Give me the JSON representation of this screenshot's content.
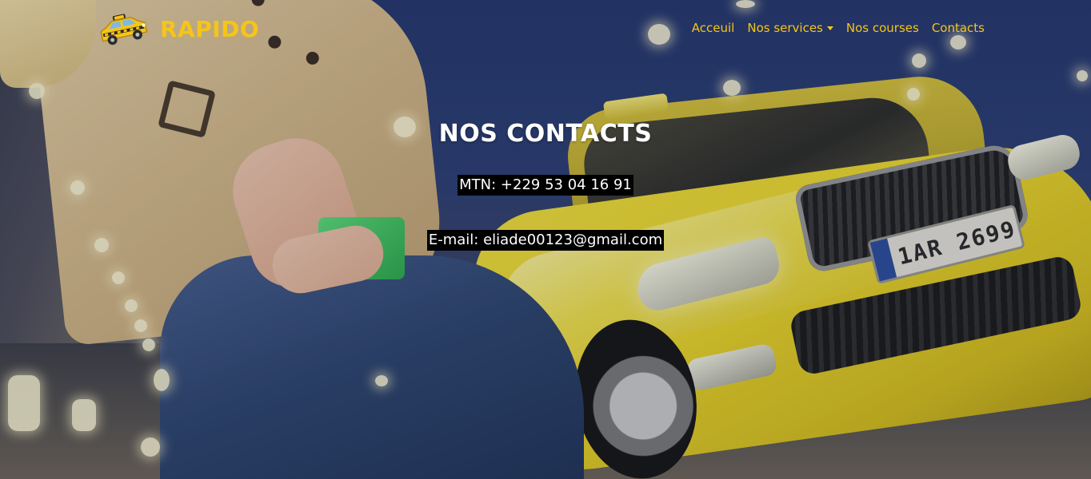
{
  "brand": {
    "name": "RAPIDO",
    "logo_icon": "taxi-icon"
  },
  "nav": {
    "links": [
      {
        "label": "Acceuil"
      },
      {
        "label": "Nos services",
        "has_dropdown": true
      },
      {
        "label": "Nos courses"
      },
      {
        "label": "Contacts"
      }
    ]
  },
  "main": {
    "title": "NOS CONTACTS",
    "phone": "MTN: +229 53 04 16 91",
    "email": "E-mail: eliade00123@gmail.com"
  },
  "background": {
    "plate": "1AR 2699"
  },
  "colors": {
    "accent": "#f5c518",
    "text": "#ffffff",
    "chip_bg": "#000000"
  }
}
